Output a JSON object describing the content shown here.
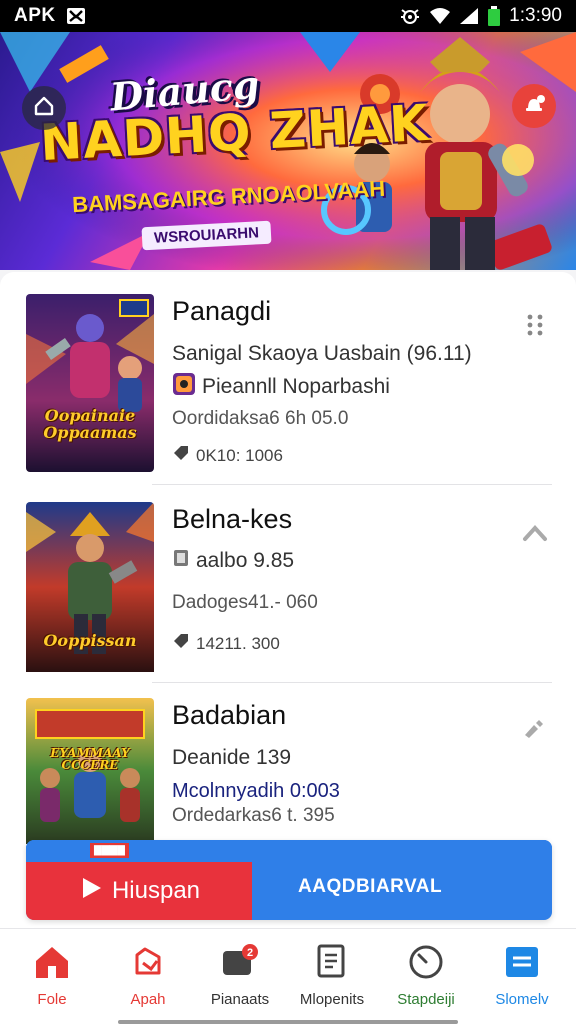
{
  "status_bar": {
    "left_label": "APK",
    "time": "1:3:90"
  },
  "banner": {
    "script_title": "Diaucg",
    "main_title": "NADHQ ZHAK",
    "subtitle": "BAMSAGAIRG RNOAOLVAAH",
    "tag": "WSROUIARHN"
  },
  "list": {
    "items": [
      {
        "title": "Panagdi",
        "line1": "Sanigal Skaoya Uasbain (96.11)",
        "line2": "Pieannll Noparbashi",
        "line3": "Oordidaksa6 6h 05.0",
        "line4": "0K10: 1006",
        "cover_text": "Oopainaie Oppaamas"
      },
      {
        "title": "Belna-kes",
        "line1": "aalbo 9.85",
        "line2": "Dadoges41.- 060",
        "line3": "14211. 300",
        "cover_text": "Ooppissan"
      },
      {
        "title": "Badabian",
        "line1": "Deanide 139",
        "line2": "Mcolnnyadih 0:003",
        "line3": "Ordedarkas6 t. 395",
        "cover_text": "EYAMMAAY CCCERE"
      }
    ]
  },
  "promo": {
    "play_label": "Hiuspan",
    "label": "AAQDBIARVAL"
  },
  "bottom_nav": {
    "items": [
      {
        "label": "Fole",
        "color": "#e53935"
      },
      {
        "label": "Apah",
        "color": "#e53935"
      },
      {
        "label": "Pianaats",
        "color": "#333333"
      },
      {
        "label": "Mlopenits",
        "color": "#333333"
      },
      {
        "label": "Stapdeiji",
        "color": "#2e7d32"
      },
      {
        "label": "Slomelv",
        "color": "#1e88e5"
      }
    ]
  }
}
